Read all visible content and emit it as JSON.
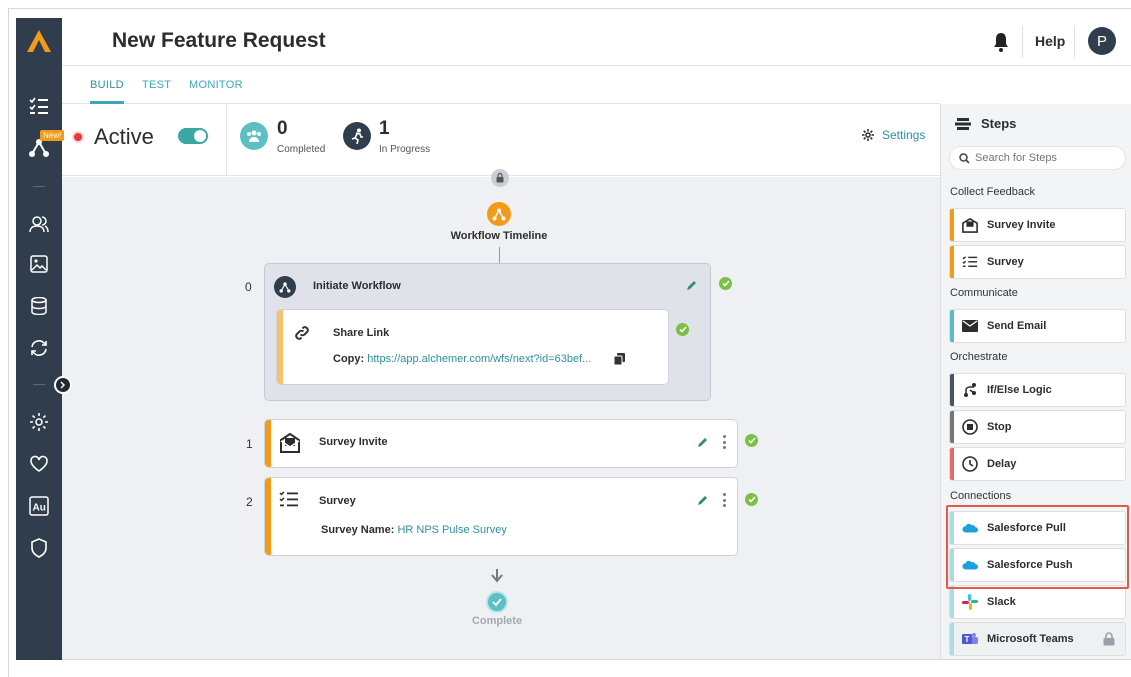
{
  "header": {
    "title": "New Feature Request",
    "help_label": "Help",
    "avatar_initial": "P"
  },
  "nav": {
    "new_badge": "New!"
  },
  "tabs": [
    {
      "label": "BUILD",
      "active": true
    },
    {
      "label": "TEST",
      "active": false
    },
    {
      "label": "MONITOR",
      "active": false
    }
  ],
  "status": {
    "state_label": "Active",
    "completed_count": "0",
    "completed_label": "Completed",
    "in_progress_count": "1",
    "in_progress_label": "In Progress",
    "settings_label": "Settings"
  },
  "timeline": {
    "label": "Workflow Timeline",
    "complete_label": "Complete",
    "initiate": {
      "index": "0",
      "title": "Initiate Workflow",
      "share": {
        "title": "Share Link",
        "copy_key": "Copy:",
        "copy_value": "https://app.alchemer.com/wfs/next?id=63bef..."
      }
    },
    "steps": [
      {
        "index": "1",
        "title": "Survey Invite"
      },
      {
        "index": "2",
        "title": "Survey",
        "field_key": "Survey Name:",
        "field_value": "HR NPS Pulse Survey"
      }
    ]
  },
  "steps_panel": {
    "title": "Steps",
    "search_placeholder": "Search for Steps",
    "categories": [
      {
        "name": "Collect Feedback",
        "items": [
          "Survey Invite",
          "Survey"
        ]
      },
      {
        "name": "Communicate",
        "items": [
          "Send Email"
        ]
      },
      {
        "name": "Orchestrate",
        "items": [
          "If/Else Logic",
          "Stop",
          "Delay"
        ]
      },
      {
        "name": "Connections",
        "items": [
          "Salesforce Pull",
          "Salesforce Push",
          "Slack",
          "Microsoft Teams"
        ]
      }
    ]
  },
  "colors": {
    "nav_bg": "#2f3d4c",
    "accent_teal": "#3aa8b8",
    "orange": "#f39a1b",
    "success_green": "#7bc043",
    "highlight_red": "#e8574a"
  }
}
